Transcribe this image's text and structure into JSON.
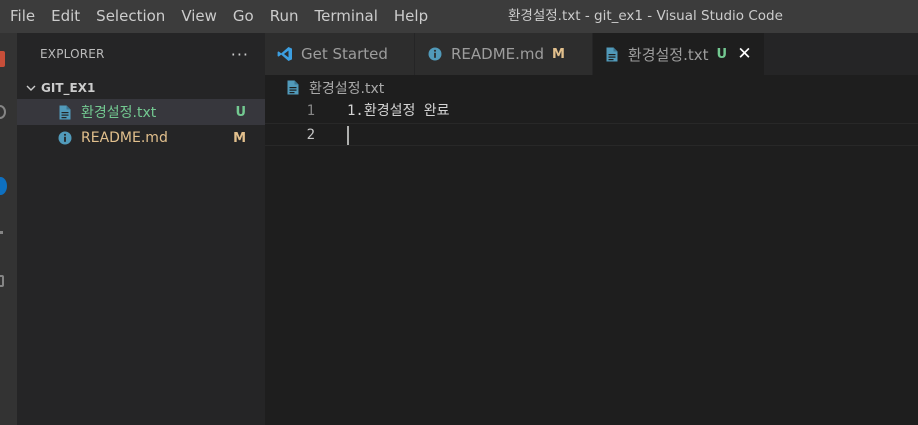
{
  "menu": [
    "File",
    "Edit",
    "Selection",
    "View",
    "Go",
    "Run",
    "Terminal",
    "Help"
  ],
  "window_title": "환경설정.txt - git_ex1 - Visual Studio Code",
  "sidebar": {
    "title": "EXPLORER",
    "more_label": "···",
    "folder": "GIT_EX1",
    "files": [
      {
        "name": "환경설정.txt",
        "status": "U",
        "icon": "file-icon",
        "selected": true
      },
      {
        "name": "README.md",
        "status": "M",
        "icon": "info-icon",
        "selected": false
      }
    ]
  },
  "tabs": [
    {
      "label": "Get Started",
      "status": "",
      "icon": "vscode-icon",
      "active": false
    },
    {
      "label": "README.md",
      "status": "M",
      "icon": "info-icon",
      "active": false
    },
    {
      "label": "환경설정.txt",
      "status": "U",
      "icon": "file-icon",
      "active": true,
      "close": "✕"
    }
  ],
  "breadcrumb": "환경설정.txt",
  "editor": {
    "lines": [
      {
        "number": "1",
        "text": "1.환경설정 완료"
      },
      {
        "number": "2",
        "text": ""
      }
    ]
  },
  "colors": {
    "accent": "#0e70c0",
    "untracked": "#73c991",
    "modified": "#e2c08d",
    "file_icon": "#519aba"
  }
}
